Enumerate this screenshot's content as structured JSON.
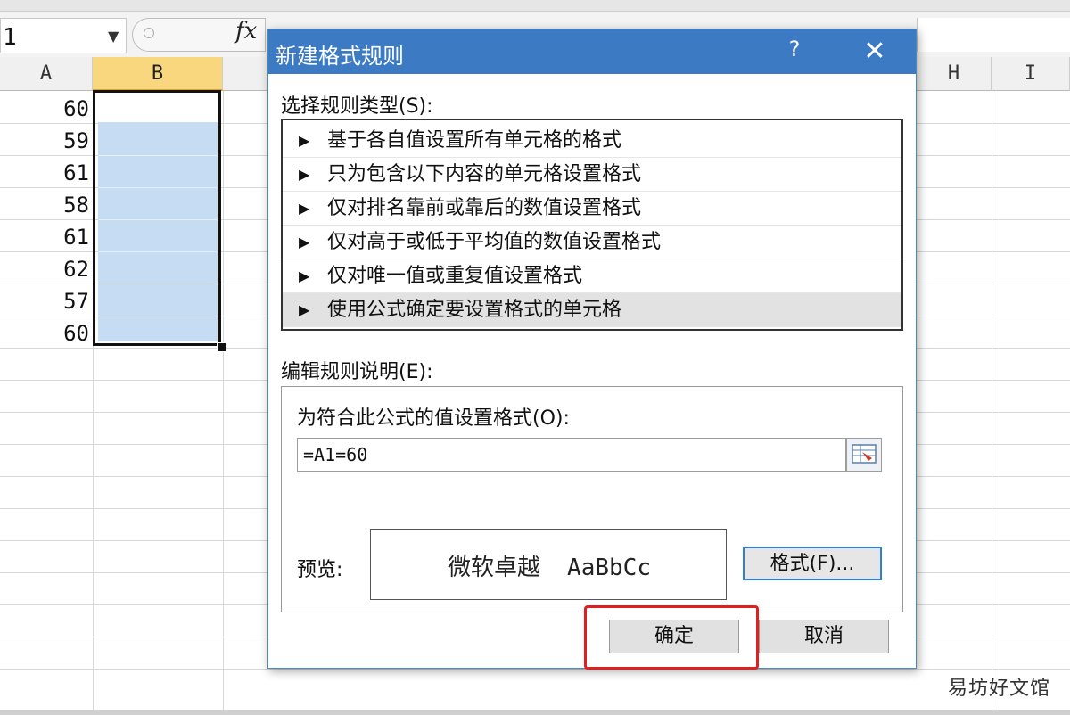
{
  "formula_bar": {
    "name_box_value": "1",
    "fx_label": "fx"
  },
  "columns": [
    {
      "id": "col-a",
      "label": "A",
      "selected": false
    },
    {
      "id": "col-b",
      "label": "B",
      "selected": true
    },
    {
      "id": "col-h",
      "label": "H",
      "selected": false
    },
    {
      "id": "col-i",
      "label": "I",
      "selected": false
    }
  ],
  "column_a_values": [
    "60",
    "59",
    "61",
    "58",
    "61",
    "62",
    "57",
    "60"
  ],
  "dialog": {
    "title": "新建格式规则",
    "help": "?",
    "close": "✕",
    "rule_type_label": "选择规则类型(S):",
    "rules": [
      "基于各自值设置所有单元格的格式",
      "只为包含以下内容的单元格设置格式",
      "仅对排名靠前或靠后的数值设置格式",
      "仅对高于或低于平均值的数值设置格式",
      "仅对唯一值或重复值设置格式",
      "使用公式确定要设置格式的单元格"
    ],
    "selected_rule_index": 5,
    "edit_rule_label": "编辑规则说明(E):",
    "formula_label": "为符合此公式的值设置格式(O):",
    "formula_value": "=A1=60",
    "preview_label": "预览:",
    "preview_cjk": "微软卓越",
    "preview_latin": "AaBbCc",
    "format_button": "格式(F)...",
    "ok_button": "确定",
    "cancel_button": "取消"
  },
  "watermark": "易坊好文馆",
  "colors": {
    "title_bar": "#3c7bc4",
    "selected_header": "#f9d77e",
    "selection_fill": "#c6dcf2",
    "highlight_border": "#e02020"
  },
  "icons": {
    "dropdown": "chevron-down-icon",
    "rule_arrow": "play-triangle-icon",
    "range_picker": "range-picker-icon"
  }
}
